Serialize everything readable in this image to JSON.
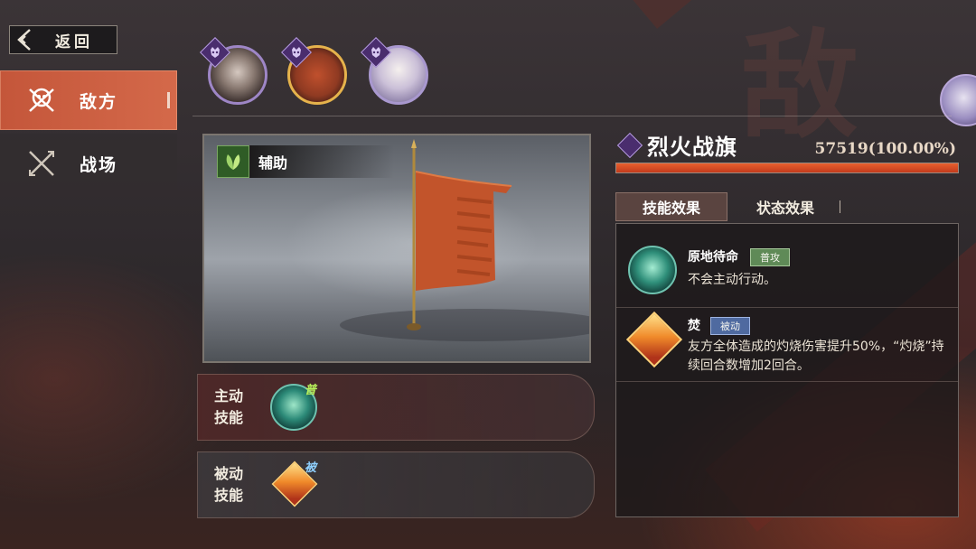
{
  "nav": {
    "back_label": "返回"
  },
  "side_tabs": [
    {
      "label": "敌方",
      "active": true
    },
    {
      "label": "战场",
      "active": false
    }
  ],
  "preview": {
    "role_tag": "辅助"
  },
  "skills": {
    "active_label": "主动\n技能",
    "active_badge": "普",
    "passive_label": "被动\n技能",
    "passive_badge": "被"
  },
  "unit": {
    "name": "烈火战旗",
    "hp_text": "57519(100.00%)",
    "hp_fraction": 1.0
  },
  "detail_tabs": [
    {
      "label": "技能效果",
      "active": true
    },
    {
      "label": "状态效果",
      "active": false
    }
  ],
  "effects": [
    {
      "name": "原地待命",
      "tag": "普攻",
      "desc": "不会主动行动。"
    },
    {
      "name": "焚",
      "tag": "被动",
      "desc": "友方全体造成的灼烧伤害提升50%，“灼烧”持续回合数增加2回合。"
    }
  ],
  "colors": {
    "accent": "#c4563a",
    "hp_bar": "#e8602f",
    "frame_gold": "#e6b34c",
    "enemy_purple": "#4a2d6e"
  },
  "icons": {
    "back": "chevron-left-icon",
    "enemy": "crossed-swords-skull-icon",
    "battlefield": "crossed-spears-icon",
    "role": "leaf-icon",
    "enemy_badge": "demon-mask-icon"
  }
}
